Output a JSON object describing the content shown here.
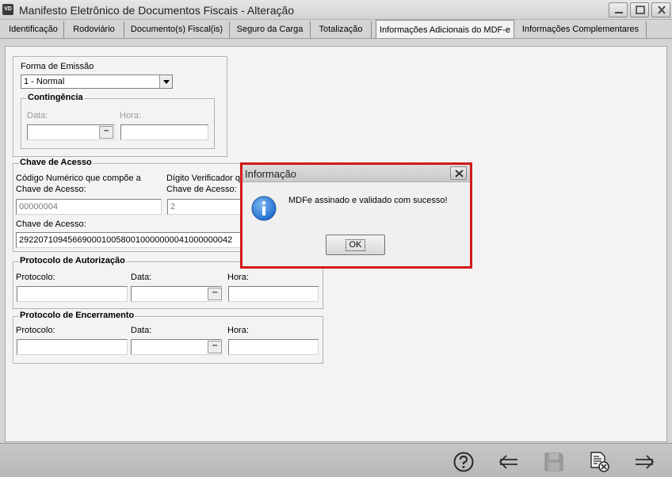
{
  "window": {
    "app_icon_text": "VD",
    "title": "Manifesto Eletrônico de Documentos Fiscais - Alteração",
    "icons": [
      "minimize-icon",
      "maximize-icon",
      "close-icon"
    ]
  },
  "tabs": [
    {
      "label": "Identificação",
      "active": false
    },
    {
      "label": "Rodoviário",
      "active": false
    },
    {
      "label": "Documento(s) Fiscal(is)",
      "active": false
    },
    {
      "label": "Seguro da Carga",
      "active": false
    },
    {
      "label": "Totalização",
      "active": false
    },
    {
      "label": "Informações Adicionais do MDF-e",
      "active": true
    },
    {
      "label": "Informações Complementares",
      "active": false
    }
  ],
  "emissao": {
    "label": "Forma de Emissão",
    "value": "1 - Normal",
    "contingencia": {
      "title": "Contingência",
      "data_label": "Data:",
      "hora_label": "Hora:",
      "data_value": "",
      "hora_value": ""
    }
  },
  "chave": {
    "title": "Chave de Acesso",
    "codigo_label_line1": "Código Numérico que compõe a",
    "codigo_label_line2": "Chave de Acesso:",
    "codigo_value": "00000004",
    "digito_label_line1": "Dígito Verificador qu",
    "digito_label_line2": "Chave de Acesso:",
    "digito_value": "2",
    "chave_label": "Chave de Acesso:",
    "chave_value": "29220710945669000100580010000000041000000042"
  },
  "autorizacao": {
    "title": "Protocolo de Autorização",
    "protocolo_label": "Protocolo:",
    "data_label": "Data:",
    "hora_label": "Hora:",
    "protocolo_value": "",
    "data_value": "",
    "hora_value": ""
  },
  "encerramento": {
    "title": "Protocolo de Encerramento",
    "protocolo_label": "Protocolo:",
    "data_label": "Data:",
    "hora_label": "Hora:",
    "protocolo_value": "",
    "data_value": "",
    "hora_value": ""
  },
  "dialog": {
    "title": "Informação",
    "message": "MDFe assinado e validado com sucesso!",
    "ok_label": "OK",
    "icon": "info-icon",
    "highlight_color": "#d21a1a",
    "info_color": "#1f6fd0"
  },
  "toolbar": {
    "icons": [
      "help-icon",
      "back-arrow-icon",
      "save-icon",
      "cancel-document-icon",
      "forward-arrow-icon"
    ],
    "save_enabled": false
  }
}
